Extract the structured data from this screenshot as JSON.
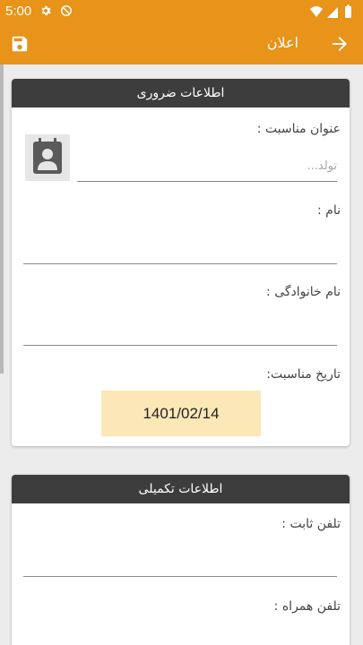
{
  "status_bar": {
    "time": "5:00"
  },
  "app_bar": {
    "title": "اعلان"
  },
  "required_section": {
    "title": "اطلاعات ضروری",
    "event_title_label": "عنوان مناسبت :",
    "event_title_placeholder": "تولد...",
    "name_label": "نام :",
    "family_label": "نام خانوادگی :",
    "date_label": "تاریخ مناسبت:",
    "date_value": "1401/02/14"
  },
  "extra_section": {
    "title": "اطلاعات تکمیلی",
    "landline_label": "تلفن ثابت :",
    "mobile_label": "تلفن همراه :"
  },
  "colors": {
    "accent": "#e8931a",
    "header_dark": "#3d3d3d",
    "date_bg": "#fbe8b6"
  }
}
